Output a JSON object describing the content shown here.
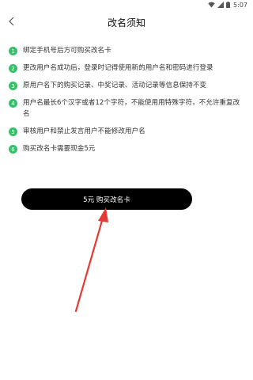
{
  "status_bar": {
    "time": "5:07"
  },
  "nav": {
    "title": "改名须知"
  },
  "rules": [
    {
      "num": "1",
      "text": "绑定手机号后方可购买改名卡"
    },
    {
      "num": "2",
      "text": "更改用户名成功后，登录时记得使用新的用户名和密码进行登录"
    },
    {
      "num": "3",
      "text": "原用户名下的购买记录、中奖记录、活动记录等信息保持不变"
    },
    {
      "num": "4",
      "text": "用户名最长6个汉字或者12个字符，不能使用用特殊字符，不允许重复改名"
    },
    {
      "num": "5",
      "text": "审核用户和禁止发言用户不能修改用户名"
    },
    {
      "num": "6",
      "text": "购买改名卡需要现金5元"
    }
  ],
  "buy_button": {
    "label": "5元 购买改名卡"
  },
  "colors": {
    "accent_green": "#35c16a",
    "button_bg": "#000000",
    "annotation_arrow": "#e53935"
  }
}
